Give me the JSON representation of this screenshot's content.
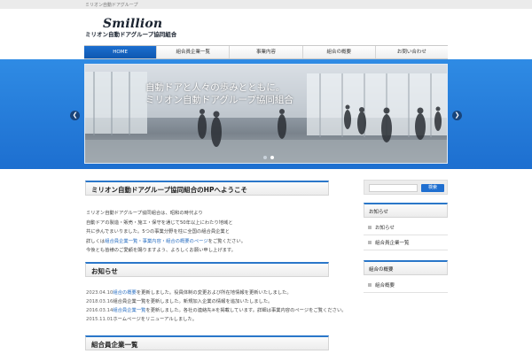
{
  "topbar": {
    "text": "ミリオン自動ドアグループ"
  },
  "logo": {
    "mark": "Smillion",
    "name": "ミリオン自動ドアグループ協同組合"
  },
  "nav": {
    "items": [
      "HOME",
      "組合員企業一覧",
      "事業内容",
      "組合の概要",
      "お問い合わせ"
    ]
  },
  "hero": {
    "caption_line1": "自動ドアと人々の歩みとともに。",
    "caption_line2": "ミリオン自動ドアグループ協同組合",
    "dots_total": 2,
    "dot_active": 1
  },
  "intro": {
    "heading": "ミリオン自動ドアグループ協同組合のHPへようこそ",
    "lines": [
      "ミリオン自動ドアグループ協同組合は、昭和の時代より",
      "自動ドアの製造・販売・施工・保守を通じて50年以上にわたり地域と",
      "共に歩んでまいりました。5つの事業分野を柱に全国の組合員企業と",
      "連携し、安全で快適な自動ドアを提供しています。",
      "今後とも皆様のご愛顧を賜りますよう、よろしくお願い申し上げます。"
    ],
    "link_prefix": "詳しくは",
    "link_text": "組合員企業一覧・事業内容・組合の概要のページ",
    "link_suffix": "をご覧ください。"
  },
  "news": {
    "heading": "お知らせ",
    "items": [
      {
        "date": "2023.04.10",
        "link": "組合の概要",
        "text": "を更新しました。役員体制の変更および所在地情報を更新いたしました。"
      },
      {
        "date": "2018.03.16",
        "link": "",
        "text": "組合員企業一覧を更新しました。新規加入企業の情報を追加いたしました。"
      },
      {
        "date": "2016.03.14",
        "link": "組合員企業一覧",
        "text": "を更新しました。各社の連絡先※を掲載しています。詳細は事業内容のページをご覧ください。"
      },
      {
        "date": "2015.11.01",
        "link": "",
        "text": "ホームページをリニューアルしました。"
      }
    ]
  },
  "members": {
    "heading": "組合員企業一覧"
  },
  "sidebar": {
    "search_button": "検索",
    "search_placeholder": "",
    "section1": {
      "title": "お知らせ",
      "items": [
        "お知らせ",
        "組合員企業一覧"
      ]
    },
    "section2": {
      "title": "組合の概要",
      "items": [
        "組合概要"
      ]
    }
  },
  "colors": {
    "brand_blue": "#1d6fd0",
    "accent_border": "#2a77c9",
    "link": "#2a6fc2"
  }
}
